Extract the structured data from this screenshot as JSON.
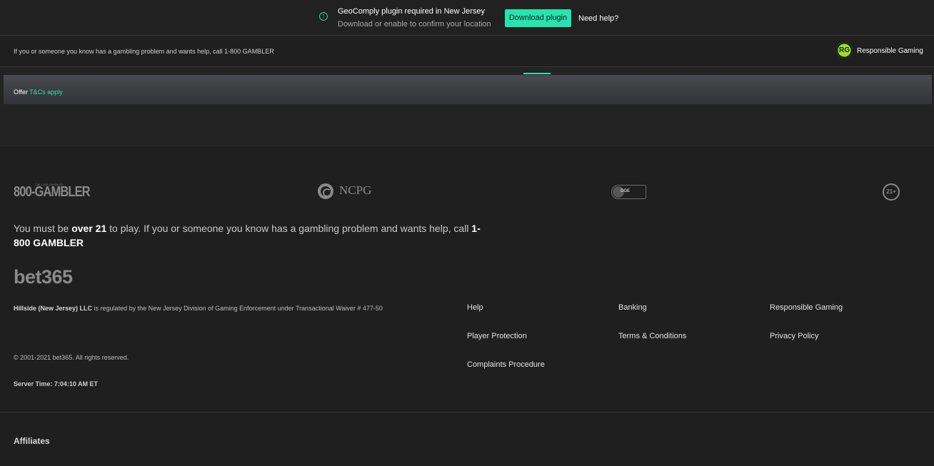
{
  "geo_banner": {
    "icon": "info-icon",
    "title": "GeoComply plugin required in New Jersey",
    "subtitle": "Download or enable to confirm your location",
    "download_label": "Download plugin",
    "help_label": "Need help?"
  },
  "help_strip": {
    "text": "If you or someone you know has a gambling problem and wants help, call 1-800 GAMBLER",
    "rg_logo": "RG",
    "rg_label": "Responsible Gaming"
  },
  "offer": {
    "prefix": "Offer",
    "link": "T&Cs apply"
  },
  "footer": {
    "logos": {
      "gambler": "800-GAMBLER",
      "gambler_small": "Call 1-800-GAMBLER",
      "ncpg": "NCPG",
      "dge": "DGE",
      "age": "21+"
    },
    "age_notice": {
      "part1": "You must be ",
      "bold1": "over 21",
      "part2": " to play. If you or someone you know has a gambling problem and wants help, call ",
      "bold2": "1-800 GAMBLER"
    },
    "brand": "bet365",
    "regulation": {
      "company": "Hillside (New Jersey) LLC",
      "text": " is regulated by the New Jersey Division of Gaming Enforcement under Transactional Waiver # 477-50"
    },
    "copyright": "© 2001-2021 bet365. All rights reserved.",
    "server_time": "Server Time: 7:04:10 AM ET",
    "links": {
      "help": "Help",
      "banking": "Banking",
      "responsible_gaming": "Responsible Gaming",
      "player_protection": "Player Protection",
      "terms": "Terms & Conditions",
      "privacy": "Privacy Policy",
      "complaints": "Complaints Procedure"
    },
    "affiliates": "Affiliates"
  },
  "colors": {
    "accent": "#26e4b0",
    "background": "#1f1f1f"
  }
}
